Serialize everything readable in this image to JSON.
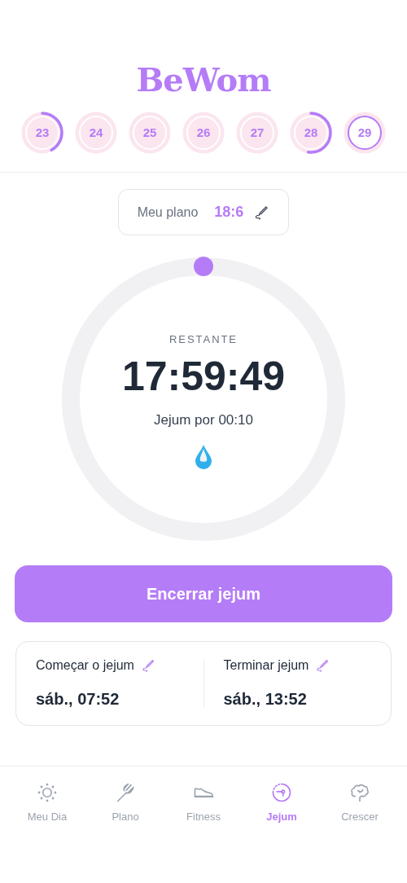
{
  "logo": "BeWom",
  "days": [
    {
      "label": "23",
      "kind": "partial",
      "selected": false
    },
    {
      "label": "24",
      "kind": "empty",
      "selected": false
    },
    {
      "label": "25",
      "kind": "empty",
      "selected": false
    },
    {
      "label": "26",
      "kind": "empty",
      "selected": false
    },
    {
      "label": "27",
      "kind": "empty",
      "selected": false
    },
    {
      "label": "28",
      "kind": "half",
      "selected": false
    },
    {
      "label": "29",
      "kind": "empty",
      "selected": true
    }
  ],
  "plan": {
    "label": "Meu plano",
    "value": "18:6"
  },
  "timer": {
    "label": "RESTANTE",
    "remaining": "17:59:49",
    "elapsed": "Jejum por 00:10"
  },
  "end_button": "Encerrar jejum",
  "schedule": [
    {
      "label": "Começar o jejum",
      "value": "sáb., 07:52"
    },
    {
      "label": "Terminar jejum",
      "value": "sáb., 13:52"
    }
  ],
  "nav": [
    {
      "label": "Meu Dia",
      "kind": "sun",
      "selected": false
    },
    {
      "label": "Plano",
      "kind": "fork",
      "selected": false
    },
    {
      "label": "Fitness",
      "kind": "shoe",
      "selected": false
    },
    {
      "label": "Jejum",
      "kind": "timer",
      "selected": true
    },
    {
      "label": "Crescer",
      "kind": "brain",
      "selected": false
    }
  ]
}
